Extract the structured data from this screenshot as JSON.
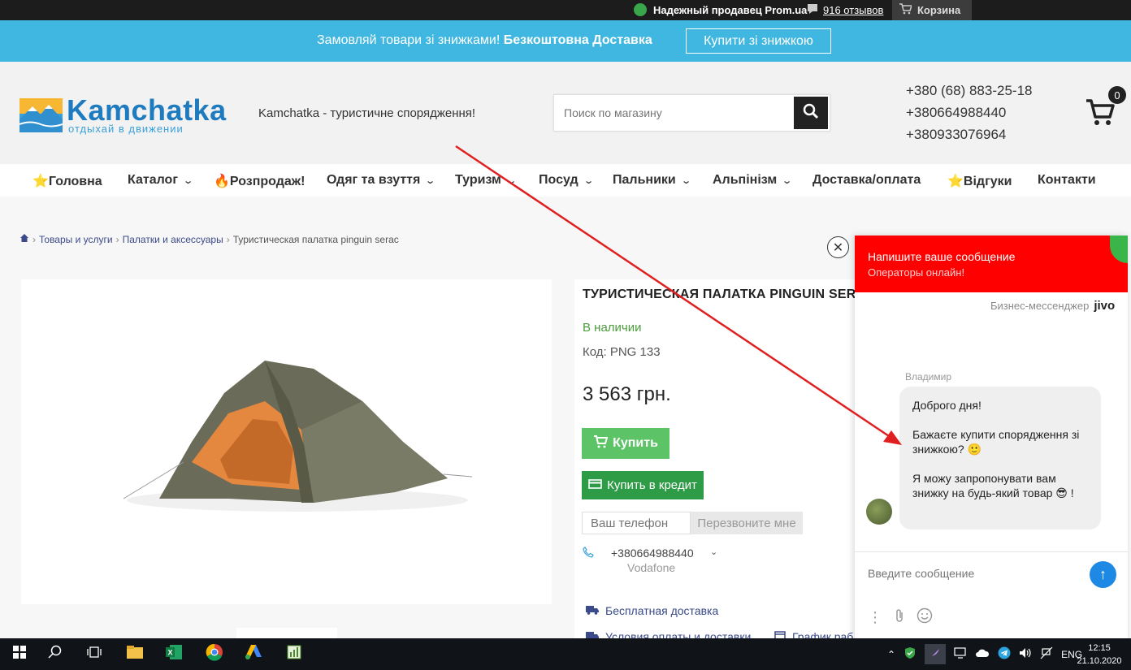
{
  "topbar": {
    "seller": "Надежный продавец Prom.ua",
    "reviews": "916 отзывов",
    "cart": "Корзина"
  },
  "promo": {
    "text": "Замовляй товари зі знижками!",
    "bold": "Безкоштовна Доставка",
    "button": "Купити зі знижкою"
  },
  "header": {
    "logo_name": "Kamchatka",
    "logo_sub": "отдыхай в движении",
    "tagline": "Kamchatka - туристичне спорядження!",
    "search_placeholder": "Поиск по магазину",
    "phones": [
      "+380 (68) 883-25-18",
      "+380664988440",
      "+380933076964"
    ],
    "cart_count": "0"
  },
  "nav": {
    "items": [
      "⭐Головна",
      "Каталог",
      "🔥Розпродаж!",
      "Одяг та взуття",
      "Туризм",
      "Посуд",
      "Пальники",
      "Альпінізм",
      "Доставка/оплата",
      "⭐Відгуки",
      "Контакти"
    ]
  },
  "breadcrumb": [
    "Товары и услуги",
    "Палатки и аксессуары",
    "Туристическая палатка pinguin serac"
  ],
  "product": {
    "title": "ТУРИСТИЧЕСКАЯ ПАЛАТКА PINGUIN SERAC",
    "availability": "В наличии",
    "code": "Код: PNG 133",
    "price": "3 563 грн.",
    "buy": "Купить",
    "credit": "Купить в кредит",
    "phone_placeholder": "Ваш телефон",
    "callback": "Перезвоните мне",
    "contact_phone": "+380664988440",
    "contact_operator": "Vodafone",
    "delivery": "Бесплатная доставка",
    "payment": "Условия оплаты и доставки",
    "schedule": "График раб"
  },
  "chat": {
    "title": "Напишите ваше сообщение",
    "subtitle": "Операторы онлайн!",
    "brand": "Бизнес-мессенджер",
    "brand_logo": "jivo",
    "agent": "Владимир",
    "messages": [
      "Доброго дня!",
      "Бажаєте купити спорядження зі знижкою? 🙂",
      "Я можу запропонувати вам знижку на будь-який товар 😎 !"
    ],
    "input_placeholder": "Введите сообщение"
  },
  "taskbar": {
    "lang": "ENG",
    "time": "12:15",
    "date": "21.10.2020"
  },
  "colors": {
    "promo": "#3fb7e0",
    "chat_header": "#fe0000",
    "buy_button": "#5cc466",
    "credit_button": "#2e9b46",
    "arrow": "#e02020"
  }
}
